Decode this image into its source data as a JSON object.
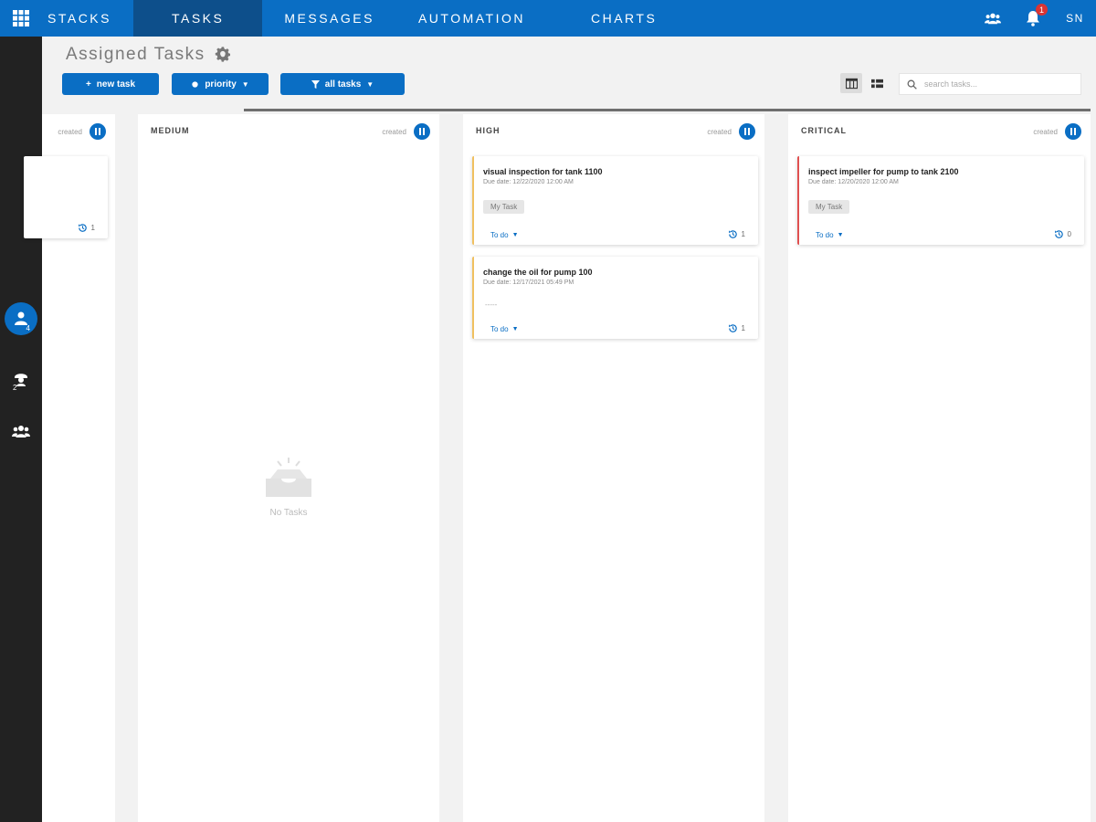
{
  "nav": {
    "items": [
      "STACKS",
      "TASKS",
      "MESSAGES",
      "AUTOMATION",
      "CHARTS"
    ],
    "active": "TASKS",
    "notification_count": "1",
    "user_initials": "SN"
  },
  "rail": {
    "items": [
      {
        "icon": "user-tasks-icon",
        "count": "4",
        "active": true
      },
      {
        "icon": "group-tasks-icon",
        "count": "2",
        "active": false
      },
      {
        "icon": "users-icon",
        "count": "",
        "active": false
      }
    ]
  },
  "header": {
    "title": "Assigned Tasks",
    "new_task_label": "new task",
    "priority_label": "priority",
    "filter_label": "all tasks",
    "search_placeholder": "search tasks..."
  },
  "columns": [
    {
      "key": "low",
      "name": "",
      "sort_label": "created",
      "cards": [
        {
          "title": "",
          "due": "",
          "tag": "",
          "status": "",
          "history": "1"
        }
      ]
    },
    {
      "key": "medium",
      "name": "MEDIUM",
      "sort_label": "created",
      "cards": [],
      "empty_text": "No Tasks"
    },
    {
      "key": "high",
      "name": "HIGH",
      "sort_label": "created",
      "cards": [
        {
          "title": "visual inspection for tank 1100",
          "due": "Due date: 12/22/2020 12:00 AM",
          "tag": "My Task",
          "status": "To do",
          "history": "1"
        },
        {
          "title": "change the oil for pump 100",
          "due": "Due date: 12/17/2021 05:49 PM",
          "tag": "-----",
          "status": "To do",
          "history": "1"
        }
      ]
    },
    {
      "key": "critical",
      "name": "CRITICAL",
      "sort_label": "created",
      "cards": [
        {
          "title": "inspect impeller for pump to tank 2100",
          "due": "Due date: 12/20/2020 12:00 AM",
          "tag": "My Task",
          "status": "To do",
          "history": "0"
        }
      ]
    }
  ],
  "colors": {
    "primary": "#0a6ec4",
    "nav_active": "#0d4f8b",
    "rail": "#222222",
    "high_accent": "#f0c060",
    "critical_accent": "#e05050"
  }
}
